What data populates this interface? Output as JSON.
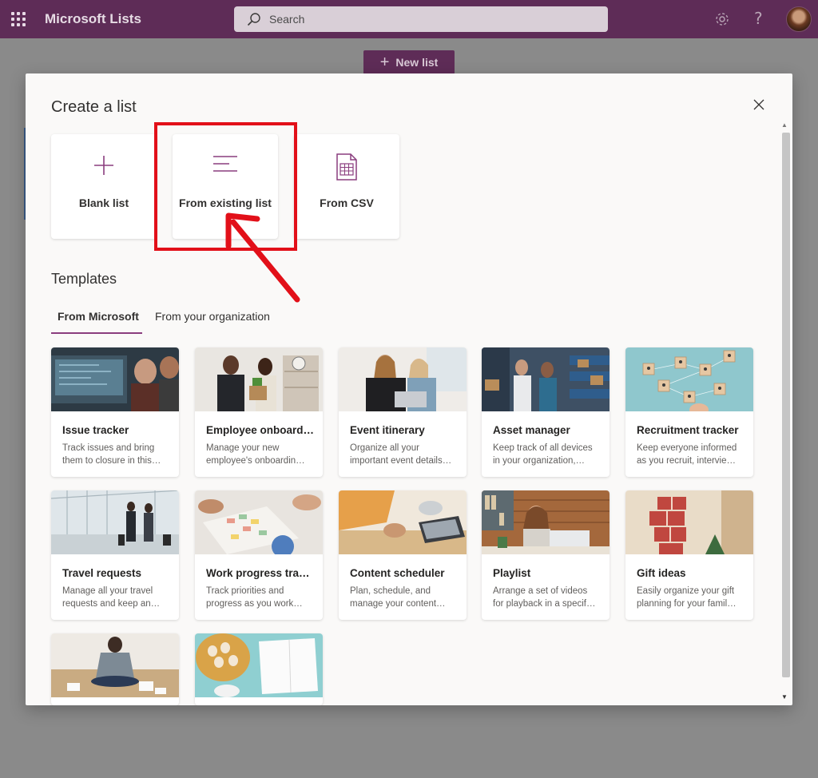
{
  "topbar": {
    "app_title": "Microsoft Lists",
    "search_placeholder": "Search"
  },
  "background": {
    "new_list_label": "New list"
  },
  "dialog": {
    "title": "Create a list",
    "options": [
      {
        "label": "Blank list",
        "icon": "plus-icon"
      },
      {
        "label": "From existing list",
        "icon": "list-lines-icon"
      },
      {
        "label": "From CSV",
        "icon": "csv-document-icon"
      }
    ],
    "templates_heading": "Templates",
    "tabs": [
      {
        "label": "From Microsoft",
        "active": true
      },
      {
        "label": "From your organization",
        "active": false
      }
    ],
    "templates": [
      {
        "name": "Issue tracker",
        "desc": "Track issues and bring them to closure in this…"
      },
      {
        "name": "Employee onboard…",
        "desc": "Manage your new employee's onboardin…"
      },
      {
        "name": "Event itinerary",
        "desc": "Organize all your important event details…"
      },
      {
        "name": "Asset manager",
        "desc": "Keep track of all devices in your organization,…"
      },
      {
        "name": "Recruitment tracker",
        "desc": "Keep everyone informed as you recruit, intervie…"
      },
      {
        "name": "Travel requests",
        "desc": "Manage all your travel requests and keep an…"
      },
      {
        "name": "Work progress tra…",
        "desc": "Track priorities and progress as you work…"
      },
      {
        "name": "Content scheduler",
        "desc": "Plan, schedule, and manage your content…"
      },
      {
        "name": "Playlist",
        "desc": "Arrange a set of videos for playback in a specif…"
      },
      {
        "name": "Gift ideas",
        "desc": "Easily organize your gift planning for your famil…"
      }
    ]
  },
  "colors": {
    "brand": "#5e2c57",
    "accent": "#8a3d7e",
    "highlight": "#e21019"
  }
}
